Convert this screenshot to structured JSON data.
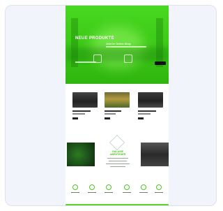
{
  "hero": {
    "title": "NEUE PRODUKTE",
    "subtitle": "Jetzt im Online-Shop",
    "button_label": "",
    "bg_color": "#3cc817"
  },
  "products": [
    {
      "image": "dark-gaming-room",
      "color": "#2b2b2b"
    },
    {
      "image": "yellow-sofa-room",
      "color": "#9a8a40"
    },
    {
      "image": "dark-table-room",
      "color": "#303030"
    }
  ],
  "middle": {
    "title_line1": "GALAXIE",
    "title_line2": "ABENTEUER",
    "left_image": "green-gaming-mat",
    "right_image": "dark-vehicle-interior"
  },
  "features": [
    {
      "icon": "truck-icon"
    },
    {
      "icon": "globe-icon"
    },
    {
      "icon": "trophy-icon"
    },
    {
      "icon": "location-icon"
    },
    {
      "icon": "box-icon"
    },
    {
      "icon": "chat-icon"
    }
  ],
  "accent": "#46c41c"
}
